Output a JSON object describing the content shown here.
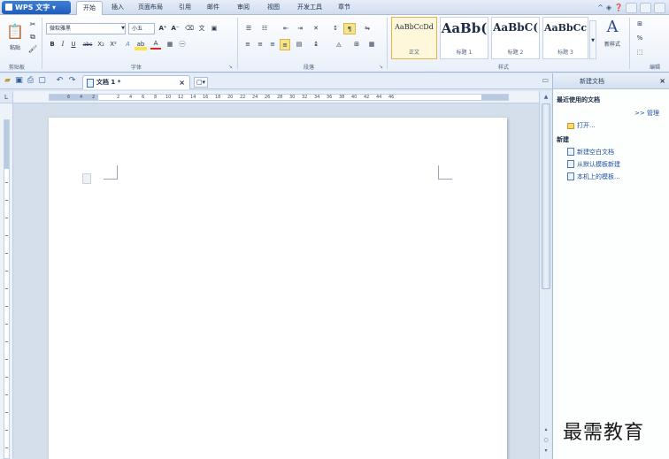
{
  "app": {
    "name": "WPS 文字",
    "menu_tabs": [
      "开始",
      "插入",
      "页面布局",
      "引用",
      "邮件",
      "审阅",
      "视图",
      "开发工具",
      "章节"
    ],
    "active_tab": "开始"
  },
  "ribbon": {
    "clipboard": {
      "paste_label": "粘贴",
      "group_label": "剪贴板"
    },
    "font": {
      "font_name": "微软雅黑",
      "font_size": "小五",
      "grow": "A⁺",
      "shrink": "A⁻",
      "bold": "B",
      "italic": "I",
      "underline": "U",
      "strike": "abc",
      "subscript": "X₂",
      "superscript": "X²",
      "font_color": "A",
      "group_label": "字体"
    },
    "paragraph": {
      "group_label": "段落"
    },
    "styles": {
      "items": [
        {
          "sample": "AaBbCcDd",
          "name": "正文"
        },
        {
          "sample": "AaBb(",
          "name": "标题 1"
        },
        {
          "sample": "AaBbC(",
          "name": "标题 2"
        },
        {
          "sample": "AaBbCc",
          "name": "标题 3"
        }
      ],
      "new_style_label": "新样式",
      "group_label": "样式"
    },
    "editing": {
      "group_label": "编辑"
    }
  },
  "document": {
    "tab_name": "文档 1 *",
    "tab_close": "×"
  },
  "ruler": {
    "h_labels": [
      "6",
      "4",
      "2",
      "2",
      "4",
      "6",
      "8",
      "10",
      "12",
      "14",
      "16",
      "18",
      "20",
      "22",
      "24",
      "26",
      "28",
      "30",
      "32",
      "34",
      "36",
      "38",
      "40",
      "42",
      "44",
      "46"
    ]
  },
  "task_pane": {
    "title": "新建文档",
    "close": "×",
    "recent_heading": "最近使用的文档",
    "manage_link": ">> 管理",
    "open_link": "打开...",
    "new_heading": "新建",
    "links": [
      "新建空白文档",
      "从默认模板新建",
      "本机上的模板..."
    ]
  },
  "watermark": "最需教育"
}
